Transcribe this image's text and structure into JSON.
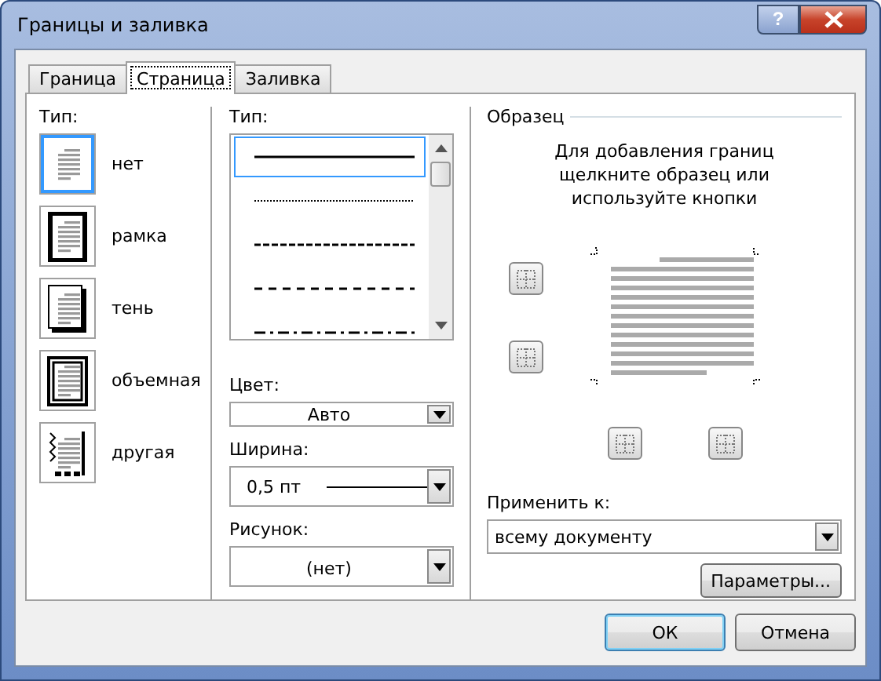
{
  "window": {
    "title": "Границы и заливка",
    "help": "?"
  },
  "tabs": [
    {
      "label": "Граница",
      "selected": false
    },
    {
      "label": "Страница",
      "selected": true
    },
    {
      "label": "Заливка",
      "selected": false
    }
  ],
  "setting": {
    "label": "Тип:",
    "items": [
      {
        "label": "нет",
        "kind": "none",
        "selected": true
      },
      {
        "label": "рамка",
        "kind": "box",
        "selected": false
      },
      {
        "label": "тень",
        "kind": "shadow",
        "selected": false
      },
      {
        "label": "объемная",
        "kind": "threed",
        "selected": false
      },
      {
        "label": "другая",
        "kind": "custom",
        "selected": false
      }
    ]
  },
  "style": {
    "label": "Тип:",
    "items": [
      {
        "kind": "solid",
        "selected": true
      },
      {
        "kind": "dotted",
        "selected": false
      },
      {
        "kind": "dashed",
        "selected": false
      },
      {
        "kind": "dash",
        "selected": false
      },
      {
        "kind": "dashdot",
        "selected": false
      }
    ]
  },
  "color": {
    "label": "Цвет:",
    "value": "Авто"
  },
  "width": {
    "label": "Ширина:",
    "value": "0,5 пт"
  },
  "art": {
    "label": "Рисунок:",
    "value": "(нет)"
  },
  "preview": {
    "label": "Образец",
    "hint": "Для добавления границ щелкните образец или используйте кнопки"
  },
  "apply": {
    "label": "Применить к:",
    "value": "всему документу"
  },
  "options_button": "Параметры...",
  "buttons": [
    "ОК",
    "Отмена"
  ]
}
